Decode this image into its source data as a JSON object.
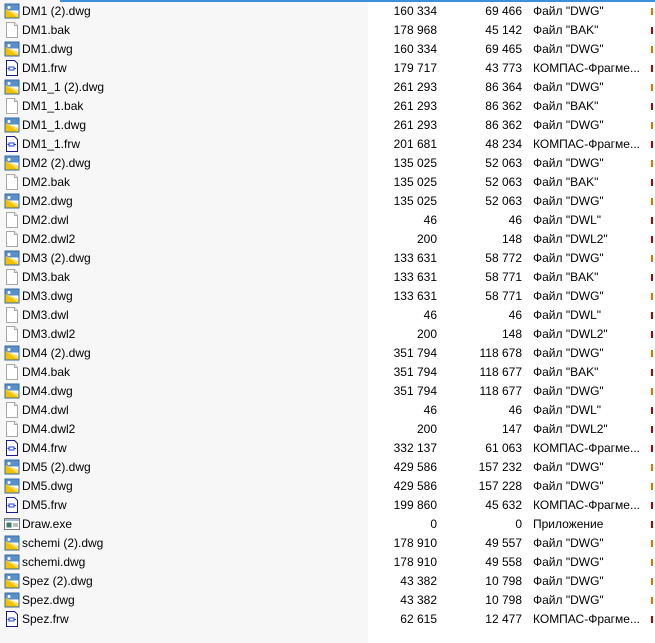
{
  "colors": {
    "accent": "#3c8fd8",
    "dwg_mark": "#e07000",
    "other_mark": "#b00000"
  },
  "files": [
    {
      "name": "DM1 (2).dwg",
      "size": "160 334",
      "packed": "69 466",
      "type": "Файл \"DWG\"",
      "icon": "dwg"
    },
    {
      "name": "DM1.bak",
      "size": "178 968",
      "packed": "45 142",
      "type": "Файл \"BAK\"",
      "icon": "blank"
    },
    {
      "name": "DM1.dwg",
      "size": "160 334",
      "packed": "69 465",
      "type": "Файл \"DWG\"",
      "icon": "dwg"
    },
    {
      "name": "DM1.frw",
      "size": "179 717",
      "packed": "43 773",
      "type": "КОМПАС-Фрагме...",
      "icon": "frw"
    },
    {
      "name": "DM1_1 (2).dwg",
      "size": "261 293",
      "packed": "86 364",
      "type": "Файл \"DWG\"",
      "icon": "dwg"
    },
    {
      "name": "DM1_1.bak",
      "size": "261 293",
      "packed": "86 362",
      "type": "Файл \"BAK\"",
      "icon": "blank"
    },
    {
      "name": "DM1_1.dwg",
      "size": "261 293",
      "packed": "86 362",
      "type": "Файл \"DWG\"",
      "icon": "dwg"
    },
    {
      "name": "DM1_1.frw",
      "size": "201 681",
      "packed": "48 234",
      "type": "КОМПАС-Фрагме...",
      "icon": "frw"
    },
    {
      "name": "DM2 (2).dwg",
      "size": "135 025",
      "packed": "52 063",
      "type": "Файл \"DWG\"",
      "icon": "dwg"
    },
    {
      "name": "DM2.bak",
      "size": "135 025",
      "packed": "52 063",
      "type": "Файл \"BAK\"",
      "icon": "blank"
    },
    {
      "name": "DM2.dwg",
      "size": "135 025",
      "packed": "52 063",
      "type": "Файл \"DWG\"",
      "icon": "dwg"
    },
    {
      "name": "DM2.dwl",
      "size": "46",
      "packed": "46",
      "type": "Файл \"DWL\"",
      "icon": "blank"
    },
    {
      "name": "DM2.dwl2",
      "size": "200",
      "packed": "148",
      "type": "Файл \"DWL2\"",
      "icon": "blank"
    },
    {
      "name": "DM3 (2).dwg",
      "size": "133 631",
      "packed": "58 772",
      "type": "Файл \"DWG\"",
      "icon": "dwg"
    },
    {
      "name": "DM3.bak",
      "size": "133 631",
      "packed": "58 771",
      "type": "Файл \"BAK\"",
      "icon": "blank"
    },
    {
      "name": "DM3.dwg",
      "size": "133 631",
      "packed": "58 771",
      "type": "Файл \"DWG\"",
      "icon": "dwg"
    },
    {
      "name": "DM3.dwl",
      "size": "46",
      "packed": "46",
      "type": "Файл \"DWL\"",
      "icon": "blank"
    },
    {
      "name": "DM3.dwl2",
      "size": "200",
      "packed": "148",
      "type": "Файл \"DWL2\"",
      "icon": "blank"
    },
    {
      "name": "DM4 (2).dwg",
      "size": "351 794",
      "packed": "118 678",
      "type": "Файл \"DWG\"",
      "icon": "dwg"
    },
    {
      "name": "DM4.bak",
      "size": "351 794",
      "packed": "118 677",
      "type": "Файл \"BAK\"",
      "icon": "blank"
    },
    {
      "name": "DM4.dwg",
      "size": "351 794",
      "packed": "118 677",
      "type": "Файл \"DWG\"",
      "icon": "dwg"
    },
    {
      "name": "DM4.dwl",
      "size": "46",
      "packed": "46",
      "type": "Файл \"DWL\"",
      "icon": "blank"
    },
    {
      "name": "DM4.dwl2",
      "size": "200",
      "packed": "147",
      "type": "Файл \"DWL2\"",
      "icon": "blank"
    },
    {
      "name": "DM4.frw",
      "size": "332 137",
      "packed": "61 063",
      "type": "КОМПАС-Фрагме...",
      "icon": "frw"
    },
    {
      "name": "DM5 (2).dwg",
      "size": "429 586",
      "packed": "157 232",
      "type": "Файл \"DWG\"",
      "icon": "dwg"
    },
    {
      "name": "DM5.dwg",
      "size": "429 586",
      "packed": "157 228",
      "type": "Файл \"DWG\"",
      "icon": "dwg"
    },
    {
      "name": "DM5.frw",
      "size": "199 860",
      "packed": "45 632",
      "type": "КОМПАС-Фрагме...",
      "icon": "frw"
    },
    {
      "name": "Draw.exe",
      "size": "0",
      "packed": "0",
      "type": "Приложение",
      "icon": "exe"
    },
    {
      "name": "schemi (2).dwg",
      "size": "178 910",
      "packed": "49 557",
      "type": "Файл \"DWG\"",
      "icon": "dwg"
    },
    {
      "name": "schemi.dwg",
      "size": "178 910",
      "packed": "49 558",
      "type": "Файл \"DWG\"",
      "icon": "dwg"
    },
    {
      "name": "Spez (2).dwg",
      "size": "43 382",
      "packed": "10 798",
      "type": "Файл \"DWG\"",
      "icon": "dwg"
    },
    {
      "name": "Spez.dwg",
      "size": "43 382",
      "packed": "10 798",
      "type": "Файл \"DWG\"",
      "icon": "dwg"
    },
    {
      "name": "Spez.frw",
      "size": "62 615",
      "packed": "12 477",
      "type": "КОМПАС-Фрагме...",
      "icon": "frw"
    }
  ]
}
